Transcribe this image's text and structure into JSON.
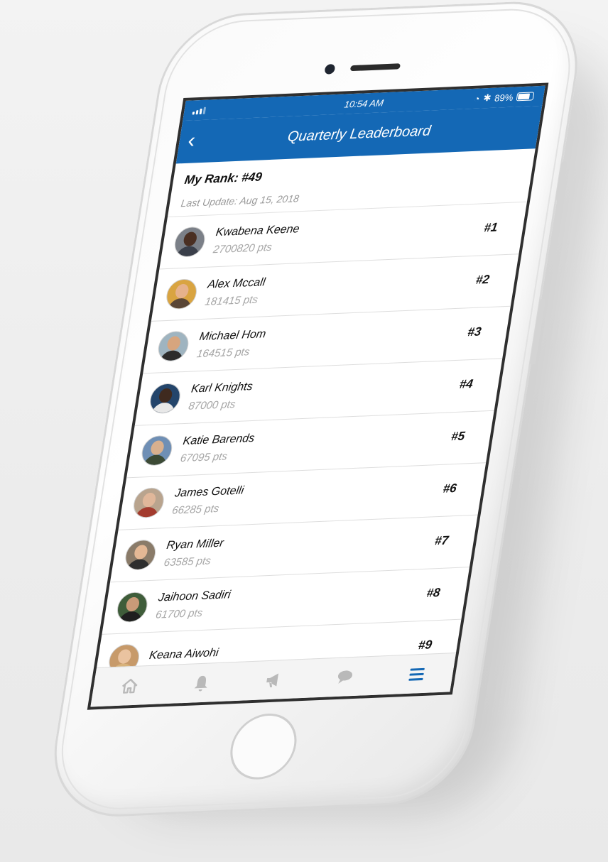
{
  "status": {
    "time": "10:54 AM",
    "battery": "89%"
  },
  "header": {
    "title": "Quarterly Leaderboard",
    "back_icon": "chevron-left-icon"
  },
  "summary": {
    "rank_label": "My Rank: #49",
    "last_update": "Last Update: Aug 15, 2018"
  },
  "leaders": [
    {
      "name": "Kwabena Keene",
      "points": "2700820 pts",
      "rank": "#1",
      "avatar_bg": "#7b8088",
      "skin": "#4a2f22",
      "shirt": "#3a3f4a"
    },
    {
      "name": "Alex Mccall",
      "points": "181415 pts",
      "rank": "#2",
      "avatar_bg": "#d9a441",
      "skin": "#e6b28c",
      "shirt": "#5a4636"
    },
    {
      "name": "Michael Hom",
      "points": "164515 pts",
      "rank": "#3",
      "avatar_bg": "#9fb4c0",
      "skin": "#d7a57e",
      "shirt": "#2c2c2c"
    },
    {
      "name": "Karl Knights",
      "points": "87000 pts",
      "rank": "#4",
      "avatar_bg": "#24456b",
      "skin": "#3f2a1f",
      "shirt": "#e8e8e8"
    },
    {
      "name": "Katie Barends",
      "points": "67095 pts",
      "rank": "#5",
      "avatar_bg": "#6f8fb5",
      "skin": "#d9b08e",
      "shirt": "#3c4a35"
    },
    {
      "name": "James Gotelli",
      "points": "66285 pts",
      "rank": "#6",
      "avatar_bg": "#b9a48e",
      "skin": "#e0b79a",
      "shirt": "#a33b2e"
    },
    {
      "name": "Ryan Miller",
      "points": "63585 pts",
      "rank": "#7",
      "avatar_bg": "#8a7b69",
      "skin": "#e4b895",
      "shirt": "#2e2e2e"
    },
    {
      "name": "Jaihoon Sadiri",
      "points": "61700 pts",
      "rank": "#8",
      "avatar_bg": "#3f5d3a",
      "skin": "#c99a78",
      "shirt": "#1f1f1f"
    },
    {
      "name": "Keana Aiwohi",
      "points": "",
      "rank": "#9",
      "avatar_bg": "#c79a6a",
      "skin": "#eac3a0",
      "shirt": "#d8b27a"
    }
  ],
  "tabs": [
    {
      "icon": "home-icon",
      "active": false
    },
    {
      "icon": "bell-icon",
      "active": false
    },
    {
      "icon": "megaphone-icon",
      "active": false
    },
    {
      "icon": "chat-icon",
      "active": false
    },
    {
      "icon": "menu-icon",
      "active": true
    }
  ],
  "colors": {
    "brand": "#1468b5",
    "tab_inactive": "#b9b9b9",
    "tab_active": "#1468b5"
  }
}
